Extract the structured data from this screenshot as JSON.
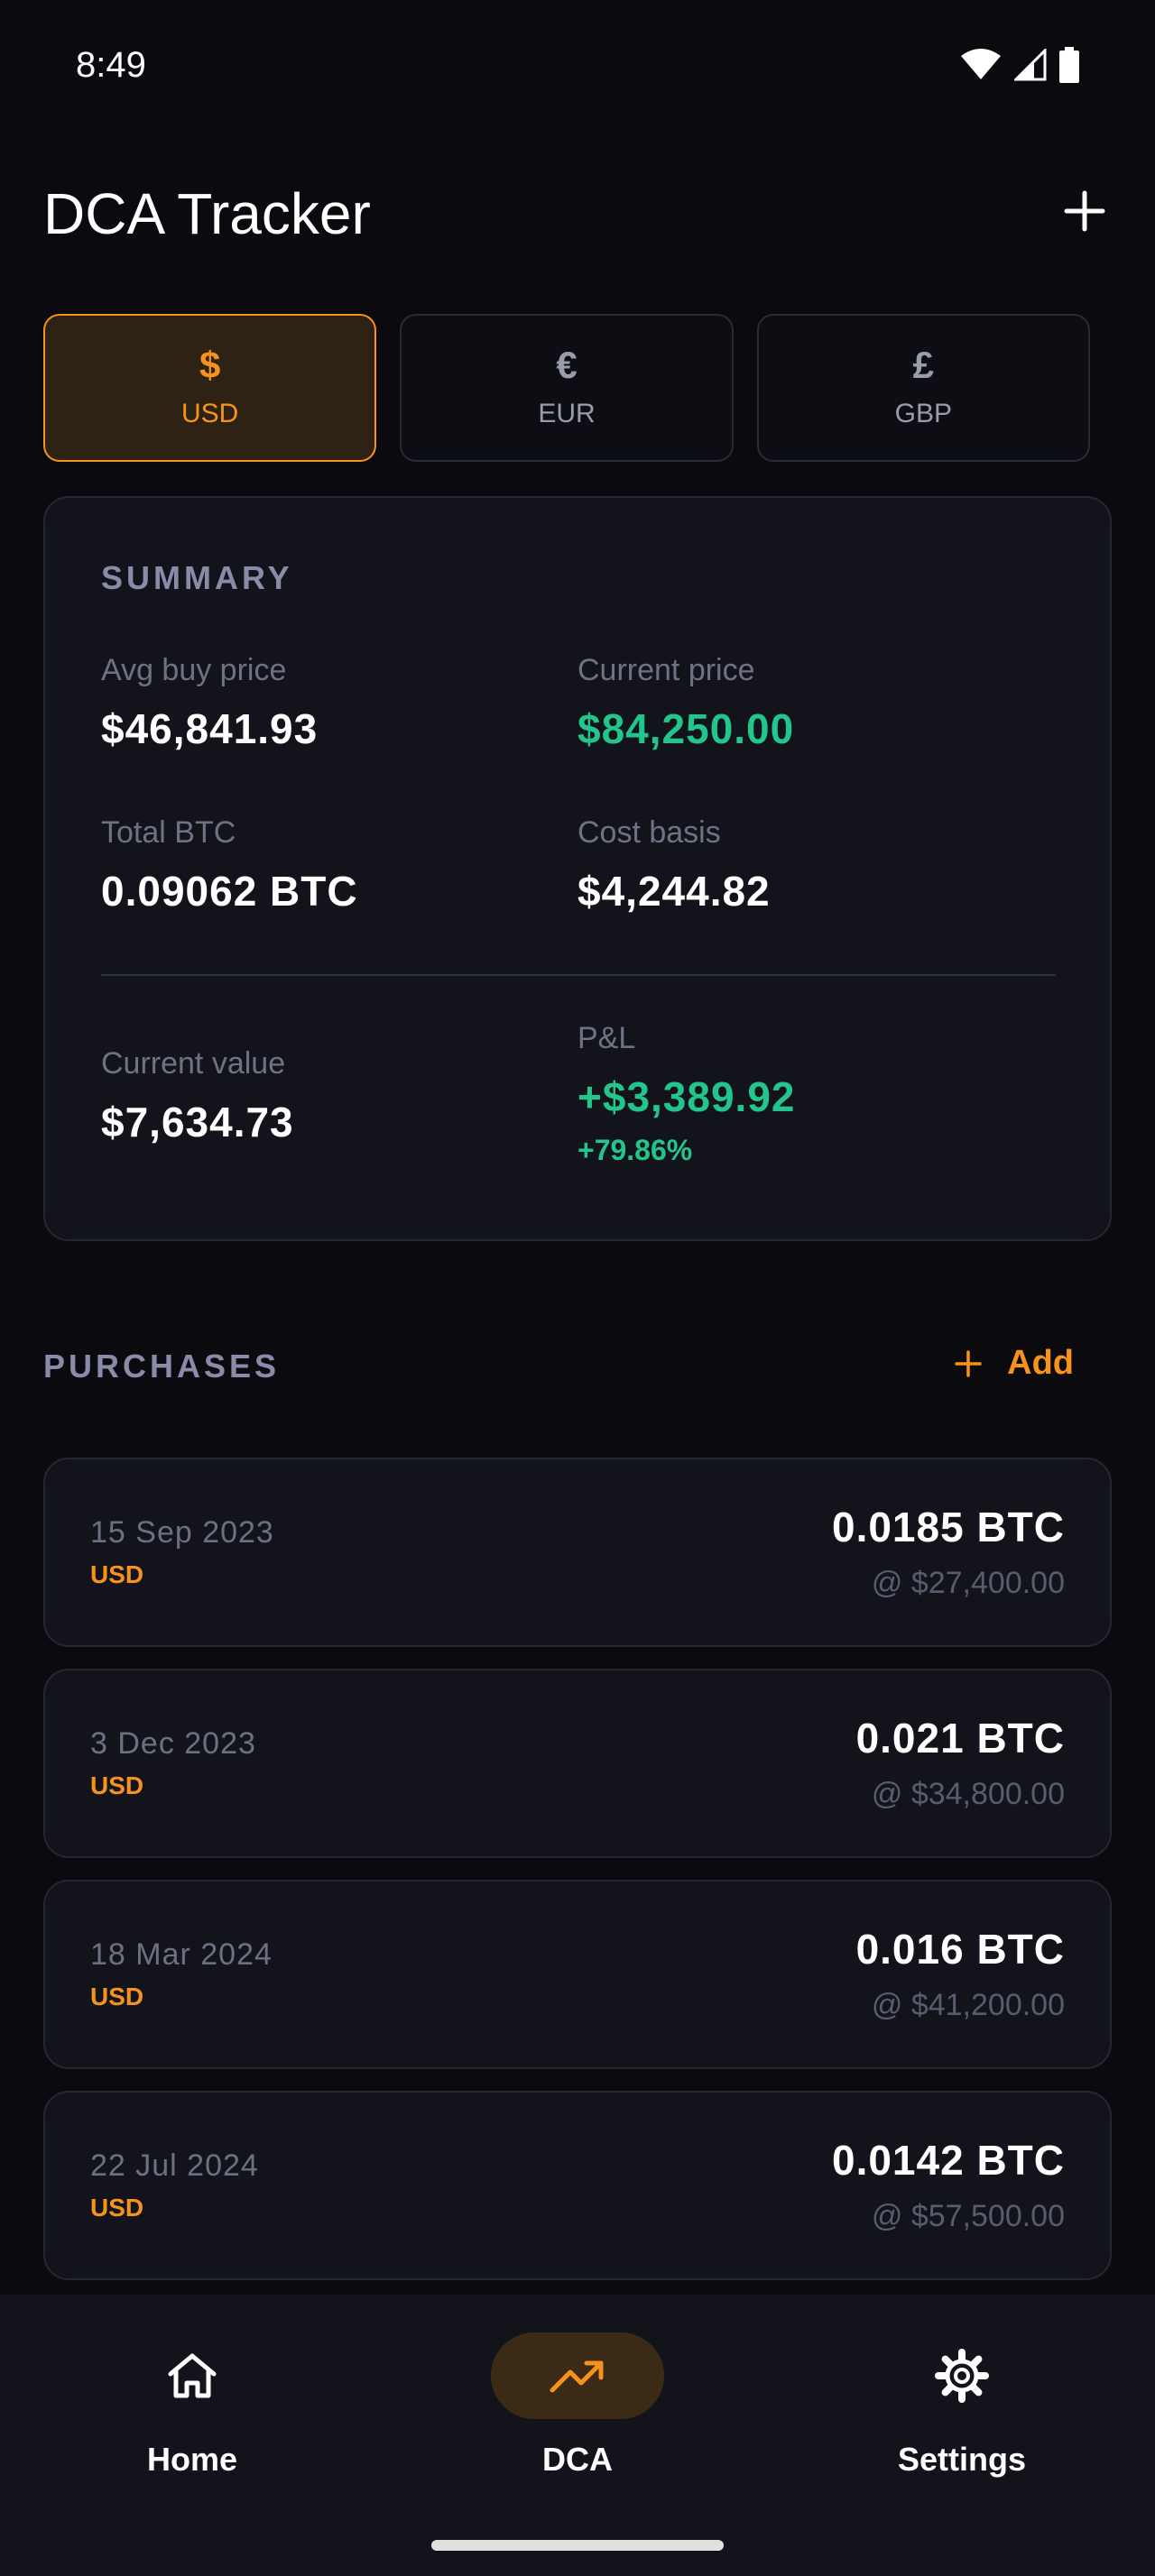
{
  "status_bar": {
    "time": "8:49"
  },
  "header": {
    "title": "DCA Tracker"
  },
  "currencies": [
    {
      "symbol": "$",
      "code": "USD",
      "active": true
    },
    {
      "symbol": "€",
      "code": "EUR",
      "active": false
    },
    {
      "symbol": "£",
      "code": "GBP",
      "active": false
    }
  ],
  "summary": {
    "title": "SUMMARY",
    "avg_buy_price": {
      "label": "Avg buy price",
      "value": "$46,841.93"
    },
    "current_price": {
      "label": "Current price",
      "value": "$84,250.00"
    },
    "total_btc": {
      "label": "Total BTC",
      "value": "0.09062 BTC"
    },
    "cost_basis": {
      "label": "Cost basis",
      "value": "$4,244.82"
    },
    "current_value": {
      "label": "Current value",
      "value": "$7,634.73"
    },
    "pnl": {
      "label": "P&L",
      "value": "+$3,389.92",
      "percent": "+79.86%"
    }
  },
  "purchases": {
    "title": "PURCHASES",
    "add_label": "Add",
    "items": [
      {
        "date": "15 Sep 2023",
        "currency": "USD",
        "amount": "0.0185 BTC",
        "price": "@ $27,400.00"
      },
      {
        "date": "3 Dec 2023",
        "currency": "USD",
        "amount": "0.021 BTC",
        "price": "@ $34,800.00"
      },
      {
        "date": "18 Mar 2024",
        "currency": "USD",
        "amount": "0.016 BTC",
        "price": "@ $41,200.00"
      },
      {
        "date": "22 Jul 2024",
        "currency": "USD",
        "amount": "0.0142 BTC",
        "price": "@ $57,500.00"
      }
    ]
  },
  "nav": {
    "home": "Home",
    "dca": "DCA",
    "settings": "Settings"
  },
  "colors": {
    "accent": "#f7931a",
    "positive": "#22c58b",
    "background": "#0a0a0f",
    "card": "#13141b"
  },
  "icons": [
    "wifi-icon",
    "signal-icon",
    "battery-icon",
    "plus-icon",
    "home-icon",
    "trending-up-icon",
    "gear-icon"
  ]
}
